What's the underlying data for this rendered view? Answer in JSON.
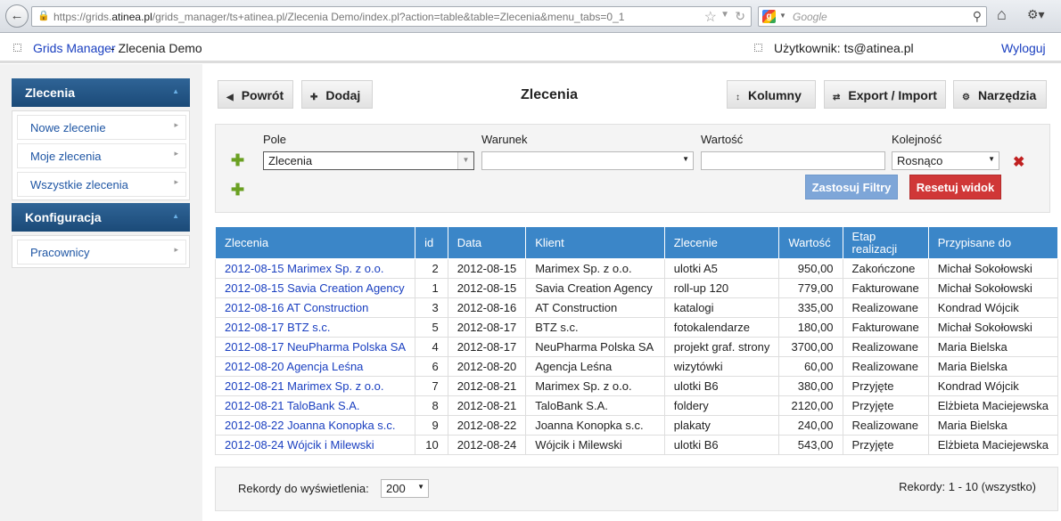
{
  "browser": {
    "url_prefix": "https://grids.",
    "url_domain": "atinea.pl",
    "url_rest": "/grids_manager/ts+atinea.pl/Zlecenia Demo/index.pl?action=table&table=Zlecenia&menu_tabs=0_1",
    "search_placeholder": "Google"
  },
  "app": {
    "brand": "Grids Manager",
    "separator": " - ",
    "project": "Zlecenia Demo",
    "user_label": "Użytkownik: ts@atinea.pl",
    "logout": "Wyloguj"
  },
  "sidebar": {
    "sections": [
      {
        "title": "Zlecenia",
        "items": [
          "Nowe zlecenie",
          "Moje zlecenia",
          "Wszystkie zlecenia"
        ]
      },
      {
        "title": "Konfiguracja",
        "items": [
          "Pracownicy"
        ]
      }
    ]
  },
  "toolbar": {
    "back": "Powrót",
    "add": "Dodaj",
    "title": "Zlecenia",
    "columns": "Kolumny",
    "export": "Export / Import",
    "tools": "Narzędzia"
  },
  "filter": {
    "labels": {
      "field": "Pole",
      "condition": "Warunek",
      "value": "Wartość",
      "order": "Kolejność"
    },
    "field_value": "Zlecenia",
    "condition_value": "",
    "value_value": "",
    "order_value": "Rosnąco",
    "apply": "Zastosuj Filtry",
    "reset": "Resetuj widok"
  },
  "table": {
    "columns": [
      "Zlecenia",
      "id",
      "Data",
      "Klient",
      "Zlecenie",
      "Wartość",
      "Etap realizacji",
      "Przypisane do"
    ],
    "rows": [
      [
        "2012-08-15 Marimex Sp. z o.o.",
        "2",
        "2012-08-15",
        "Marimex Sp. z o.o.",
        "ulotki A5",
        "950,00",
        "Zakończone",
        "Michał Sokołowski"
      ],
      [
        "2012-08-15 Savia Creation Agency",
        "1",
        "2012-08-15",
        "Savia Creation Agency",
        "roll-up 120",
        "779,00",
        "Fakturowane",
        "Michał Sokołowski"
      ],
      [
        "2012-08-16 AT Construction",
        "3",
        "2012-08-16",
        "AT Construction",
        "katalogi",
        "335,00",
        "Realizowane",
        "Kondrad Wójcik"
      ],
      [
        "2012-08-17 BTZ s.c.",
        "5",
        "2012-08-17",
        "BTZ s.c.",
        "fotokalendarze",
        "180,00",
        "Fakturowane",
        "Michał Sokołowski"
      ],
      [
        "2012-08-17 NeuPharma Polska SA",
        "4",
        "2012-08-17",
        "NeuPharma Polska SA",
        "projekt graf. strony",
        "3700,00",
        "Realizowane",
        "Maria Bielska"
      ],
      [
        "2012-08-20 Agencja Leśna",
        "6",
        "2012-08-20",
        "Agencja Leśna",
        "wizytówki",
        "60,00",
        "Realizowane",
        "Maria Bielska"
      ],
      [
        "2012-08-21 Marimex Sp. z o.o.",
        "7",
        "2012-08-21",
        "Marimex Sp. z o.o.",
        "ulotki B6",
        "380,00",
        "Przyjęte",
        "Kondrad Wójcik"
      ],
      [
        "2012-08-21 TaloBank S.A.",
        "8",
        "2012-08-21",
        "TaloBank S.A.",
        "foldery",
        "2120,00",
        "Przyjęte",
        "Elżbieta Maciejewska"
      ],
      [
        "2012-08-22 Joanna Konopka s.c.",
        "9",
        "2012-08-22",
        "Joanna Konopka s.c.",
        "plakaty",
        "240,00",
        "Realizowane",
        "Maria Bielska"
      ],
      [
        "2012-08-24 Wójcik i Milewski",
        "10",
        "2012-08-24",
        "Wójcik i Milewski",
        "ulotki B6",
        "543,00",
        "Przyjęte",
        "Elżbieta Maciejewska"
      ]
    ]
  },
  "footer": {
    "per_page_label": "Rekordy do wyświetlenia:",
    "per_page_value": "200",
    "records": "Rekordy: 1 - 10 (wszystko)"
  },
  "colors": {
    "header_blue": "#3b86c8",
    "sidebar_blue": "#1b4a78",
    "apply": "#7ea6d8",
    "reset": "#d03737",
    "link": "#1a3fc0"
  },
  "icons": [
    "back-arrow-icon",
    "lock-icon",
    "star-icon",
    "reload-icon",
    "google-icon",
    "search-icon",
    "home-icon",
    "tools-menu-icon",
    "plus-icon",
    "remove-icon",
    "chevron-right-icon",
    "collapse-icon"
  ]
}
